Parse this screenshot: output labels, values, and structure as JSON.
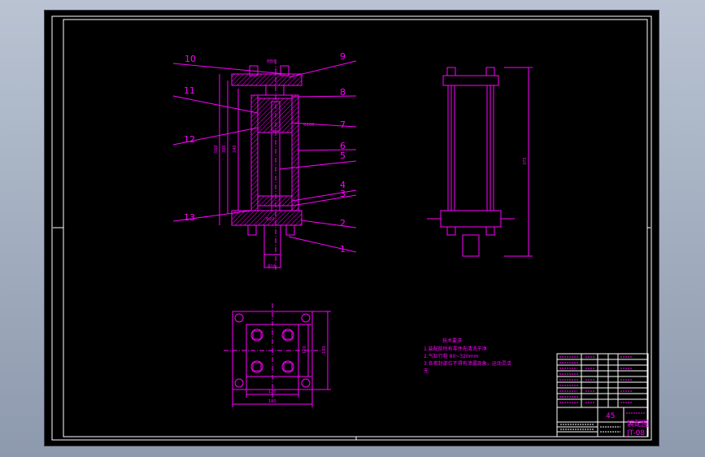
{
  "callouts": [
    "10",
    "9",
    "11",
    "8",
    "7",
    "12",
    "6",
    "5",
    "4",
    "3",
    "13",
    "2",
    "1"
  ],
  "technical_requirements": {
    "title": "技术要求",
    "items": [
      "1.装配前所有零件先清洗干净",
      "2.气缸行程 80~320mm",
      "3.各密封部位不得有泄漏现象，运动灵活",
      "无"
    ]
  },
  "title_block": {
    "scale_value": "45",
    "drawing_name": "装配图",
    "drawing_number": "JT-08"
  },
  "colors": {
    "line": "#ff00ff",
    "frame": "#ffffff",
    "background": "#000000"
  }
}
